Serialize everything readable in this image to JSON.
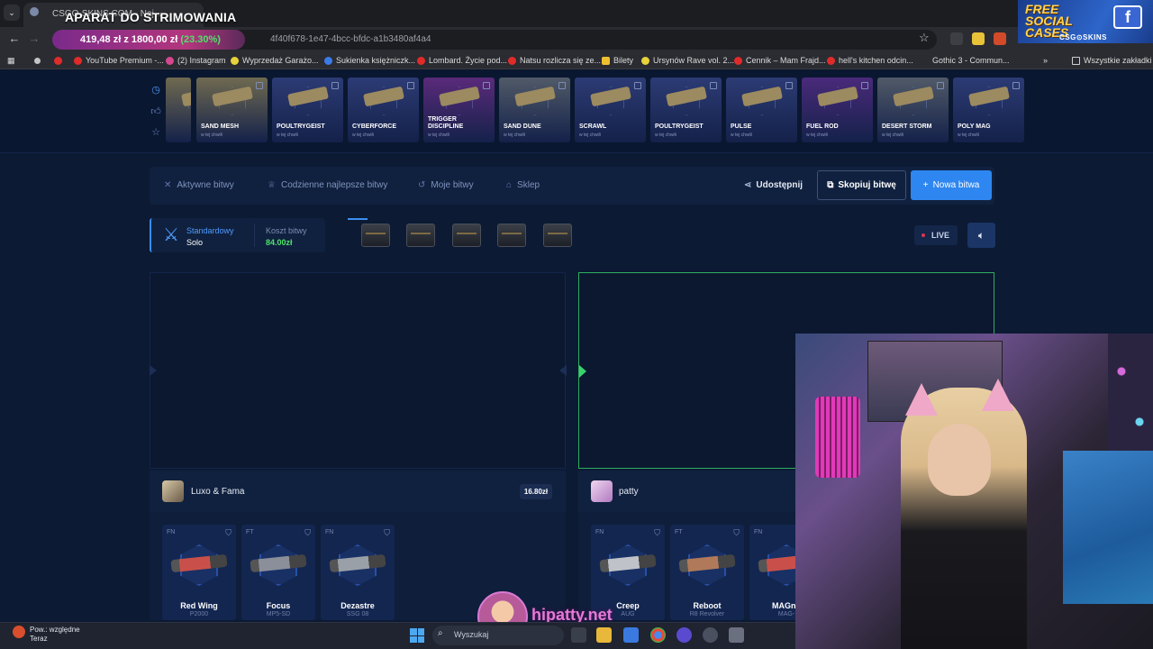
{
  "overlay": {
    "title": "APARAT DO STRIMOWANIA",
    "progress_text": "419,48 zł z 1800,00 zł",
    "progress_percent": "(23.30%)"
  },
  "browser": {
    "tab_title": "CSGO-SKINS.COM - Naj...",
    "url": "4f40f678-1e47-4bcc-bfdc-a1b3480af4a4",
    "bookmarks": [
      "YouTube Premium -...",
      "(2) Instagram",
      "Wyprzedaż Garażo...",
      "Sukienka księżniczk...",
      "Lombard. Życie pod...",
      "Natsu rozlicza się ze...",
      "Bilety",
      "Ursynów Rave vol. 2...",
      "Cennik – Mam Frajd...",
      "hell's kitchen odcin...",
      "Gothic 3 - Commun..."
    ],
    "bookmarks_more": "»",
    "bookmarks_all": "Wszystkie zakładki"
  },
  "promo": {
    "line1": "FREE",
    "line2": "SOCIAL",
    "line3": "CASES",
    "brand": "CSG⊙SKINS"
  },
  "live_drops": {
    "subtitle": "w tej chwili",
    "items": [
      {
        "name": "",
        "color": "#6f6a50"
      },
      {
        "name": "SAND MESH",
        "color": "#6f6a50"
      },
      {
        "name": "POULTRYGEIST",
        "color": "#2c3b74"
      },
      {
        "name": "CYBERFORCE",
        "color": "#2c3b74"
      },
      {
        "name": "TRIGGER DISCIPLINE",
        "color": "#5a2a7a"
      },
      {
        "name": "SAND DUNE",
        "color": "#505a68"
      },
      {
        "name": "SCRAWL",
        "color": "#2c3b74"
      },
      {
        "name": "POULTRYGEIST",
        "color": "#2c3b74"
      },
      {
        "name": "PULSE",
        "color": "#2c3b74"
      },
      {
        "name": "FUEL ROD",
        "color": "#4a2a7a"
      },
      {
        "name": "DESERT STORM",
        "color": "#505a68"
      },
      {
        "name": "POLY MAG",
        "color": "#2c3b74"
      }
    ]
  },
  "nav": {
    "active_battles": "Aktywne bitwy",
    "daily_best": "Codzienne najlepsze bitwy",
    "my_battles": "Moje bitwy",
    "shop": "Sklep",
    "share": "Udostępnij",
    "copy": "Skopiuj bitwę",
    "new": "Nowa bitwa"
  },
  "battle": {
    "mode": "Standardowy",
    "mode_sub": "Solo",
    "cost_label": "Koszt bitwy",
    "cost_value": "84.00zł",
    "live": "LIVE"
  },
  "players": [
    {
      "name": "Luxo & Fama",
      "total": "16.80zł",
      "items": [
        {
          "cond": "FN",
          "name": "Red Wing",
          "weapon": "P2000",
          "gun_color": "#c9504a"
        },
        {
          "cond": "FT",
          "name": "Focus",
          "weapon": "MP5-SD",
          "gun_color": "#8b8f9a"
        },
        {
          "cond": "FN",
          "name": "Dezastre",
          "weapon": "SSG 08",
          "gun_color": "#9aa0a8"
        }
      ]
    },
    {
      "name": "patty",
      "total": "",
      "items": [
        {
          "cond": "FN",
          "name": "Creep",
          "weapon": "AUG",
          "gun_color": "#bfc3c9"
        },
        {
          "cond": "FT",
          "name": "Reboot",
          "weapon": "R8 Revolver",
          "gun_color": "#b07a5a"
        },
        {
          "cond": "FN",
          "name": "MAGnit",
          "weapon": "MAG-",
          "gun_color": "#c9504a"
        }
      ]
    }
  ],
  "streamer": {
    "handle": "hipatty.net"
  },
  "taskbar": {
    "weather_line1": "Pow.: względne",
    "weather_line2": "Teraz",
    "search": "Wyszukaj"
  }
}
